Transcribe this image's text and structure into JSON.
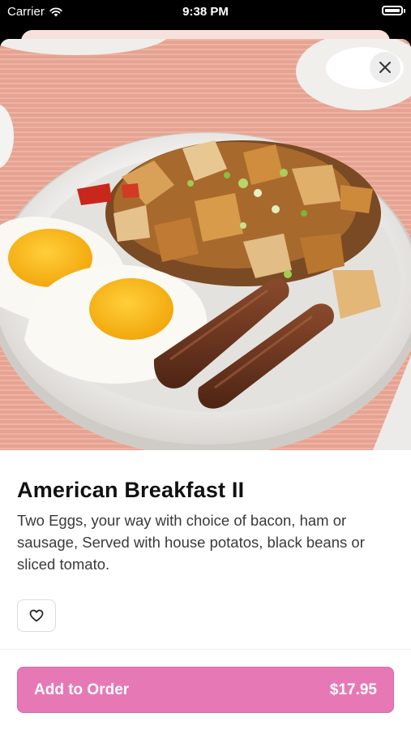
{
  "status_bar": {
    "carrier": "Carrier",
    "time": "9:38 PM"
  },
  "item": {
    "title": "American Breakfast II",
    "description": "Two Eggs, your way with choice of bacon, ham or sausage, Served with house potatos, black beans or sliced tomato."
  },
  "order_button": {
    "label": "Add to Order",
    "price": "$17.95"
  },
  "icons": {
    "close": "close-icon",
    "favorite": "heart-icon",
    "wifi": "wifi-icon",
    "battery": "battery-icon"
  },
  "colors": {
    "accent": "#e679b5",
    "table": "#e9a596",
    "plate": "#ececea"
  }
}
